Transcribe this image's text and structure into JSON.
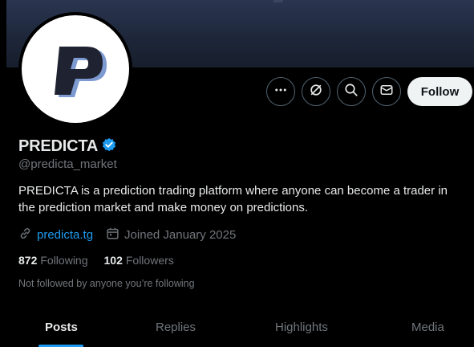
{
  "profile": {
    "name": "PREDICTA",
    "handle": "@predicta_market",
    "bio": "PREDICTA is a prediction trading platform where anyone can become a trader in the prediction market and make money on predictions.",
    "website": "predicta.tg",
    "joined": "Joined January 2025",
    "verified": true
  },
  "stats": {
    "following_count": "872",
    "following_label": "Following",
    "followers_count": "102",
    "followers_label": "Followers"
  },
  "not_followed_text": "Not followed by anyone you’re following",
  "actions": {
    "follow_label": "Follow"
  },
  "tabs": [
    {
      "label": "Posts",
      "active": true
    },
    {
      "label": "Replies",
      "active": false
    },
    {
      "label": "Highlights",
      "active": false
    },
    {
      "label": "Media",
      "active": false
    }
  ],
  "icons": [
    "more-icon",
    "grok-icon",
    "search-icon",
    "message-icon",
    "verified-badge-icon",
    "link-icon",
    "calendar-icon"
  ],
  "colors": {
    "accent": "#1d9bf0",
    "background": "#000000",
    "text": "#e7e9ea",
    "muted": "#71767b",
    "follow_button": "#eff3f4"
  }
}
